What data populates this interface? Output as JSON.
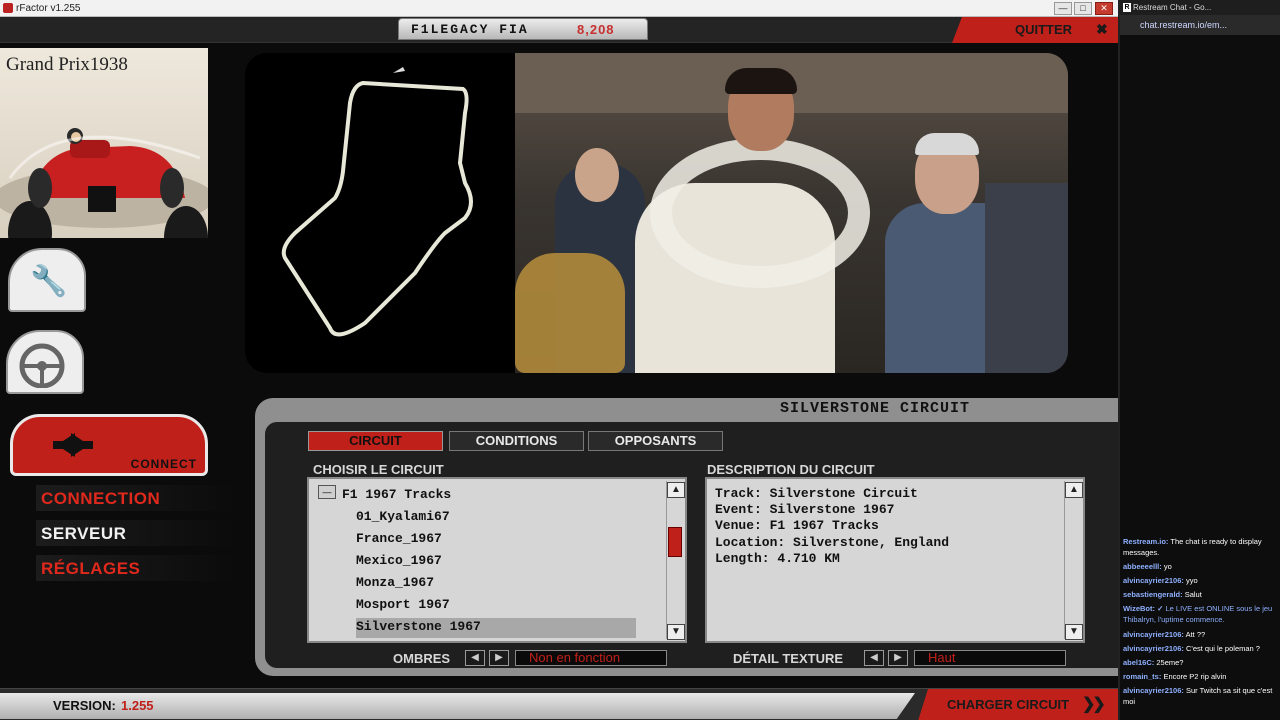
{
  "window": {
    "title": "rFactor v1.255",
    "min": "—",
    "max": "□",
    "close": "✕"
  },
  "topbar": {
    "logo": "F1LEGACY FIA",
    "number": "8,208",
    "quit": "QUITTER",
    "quit_icon": "✖"
  },
  "sidebar": {
    "banner": "Grand Prix1938",
    "settings_icon": "wrench-icon",
    "driving_icon": "steering-wheel-icon",
    "connect_label": "CONNECT",
    "menu": [
      "CONNECTION",
      "SERVEUR",
      "RÉGLAGES"
    ]
  },
  "panel": {
    "title": "SILVERSTONE CIRCUIT",
    "tabs": [
      "CIRCUIT",
      "CONDITIONS",
      "OPPOSANTS"
    ],
    "left_header": "CHOISIR LE CIRCUIT",
    "right_header": "DESCRIPTION DU CIRCUIT",
    "tree_toggle": "—",
    "list": [
      "F1 1967 Tracks",
      "01_Kyalami67",
      "France_1967",
      "Mexico_1967",
      "Monza_1967",
      "Mosport 1967",
      "Silverstone 1967"
    ],
    "selected": "Silverstone 1967",
    "description": [
      "Track: Silverstone Circuit",
      "Event: Silverstone 1967",
      "Venue: F1 1967 Tracks",
      "Location: Silverstone, England",
      "Length: 4.710 KM"
    ],
    "shadows_label": "OMBRES",
    "shadows_value": "Non en fonction",
    "texture_label": "DÉTAIL TEXTURE",
    "texture_value": "Haut",
    "arrow_left": "◀",
    "arrow_right": "▶",
    "arrow_up": "▲",
    "arrow_down": "▼"
  },
  "bottombar": {
    "version_label": "VERSION:",
    "version": "1.255",
    "load": "CHARGER CIRCUIT",
    "load_arrows": "❯❯"
  },
  "chat": {
    "title": "Restream Chat - Go...",
    "address": "chat.restream.io/em...",
    "messages": [
      {
        "user": "Restream.io:",
        "text": "The chat is ready to display messages."
      },
      {
        "user": "abbeeeelll:",
        "text": "yo"
      },
      {
        "user": "alvincayrier2106:",
        "text": "yyo"
      },
      {
        "user": "sebastiengerald:",
        "text": "Salut"
      },
      {
        "user": "WizeBot: ✓",
        "text": "Le LIVE est ONLINE sous le jeu Thibalryn, l'uptime commence."
      },
      {
        "user": "alvincayrier2106:",
        "text": "Att ??"
      },
      {
        "user": "alvincayrier2106:",
        "text": "C'est qui le poleman ?"
      },
      {
        "user": "abel16C:",
        "text": "25eme?"
      },
      {
        "user": "romain_ts:",
        "text": "Encore P2 rip alvin"
      },
      {
        "user": "alvincayrier2106:",
        "text": "Sur Twitch sa sit que c'est moi"
      }
    ]
  }
}
